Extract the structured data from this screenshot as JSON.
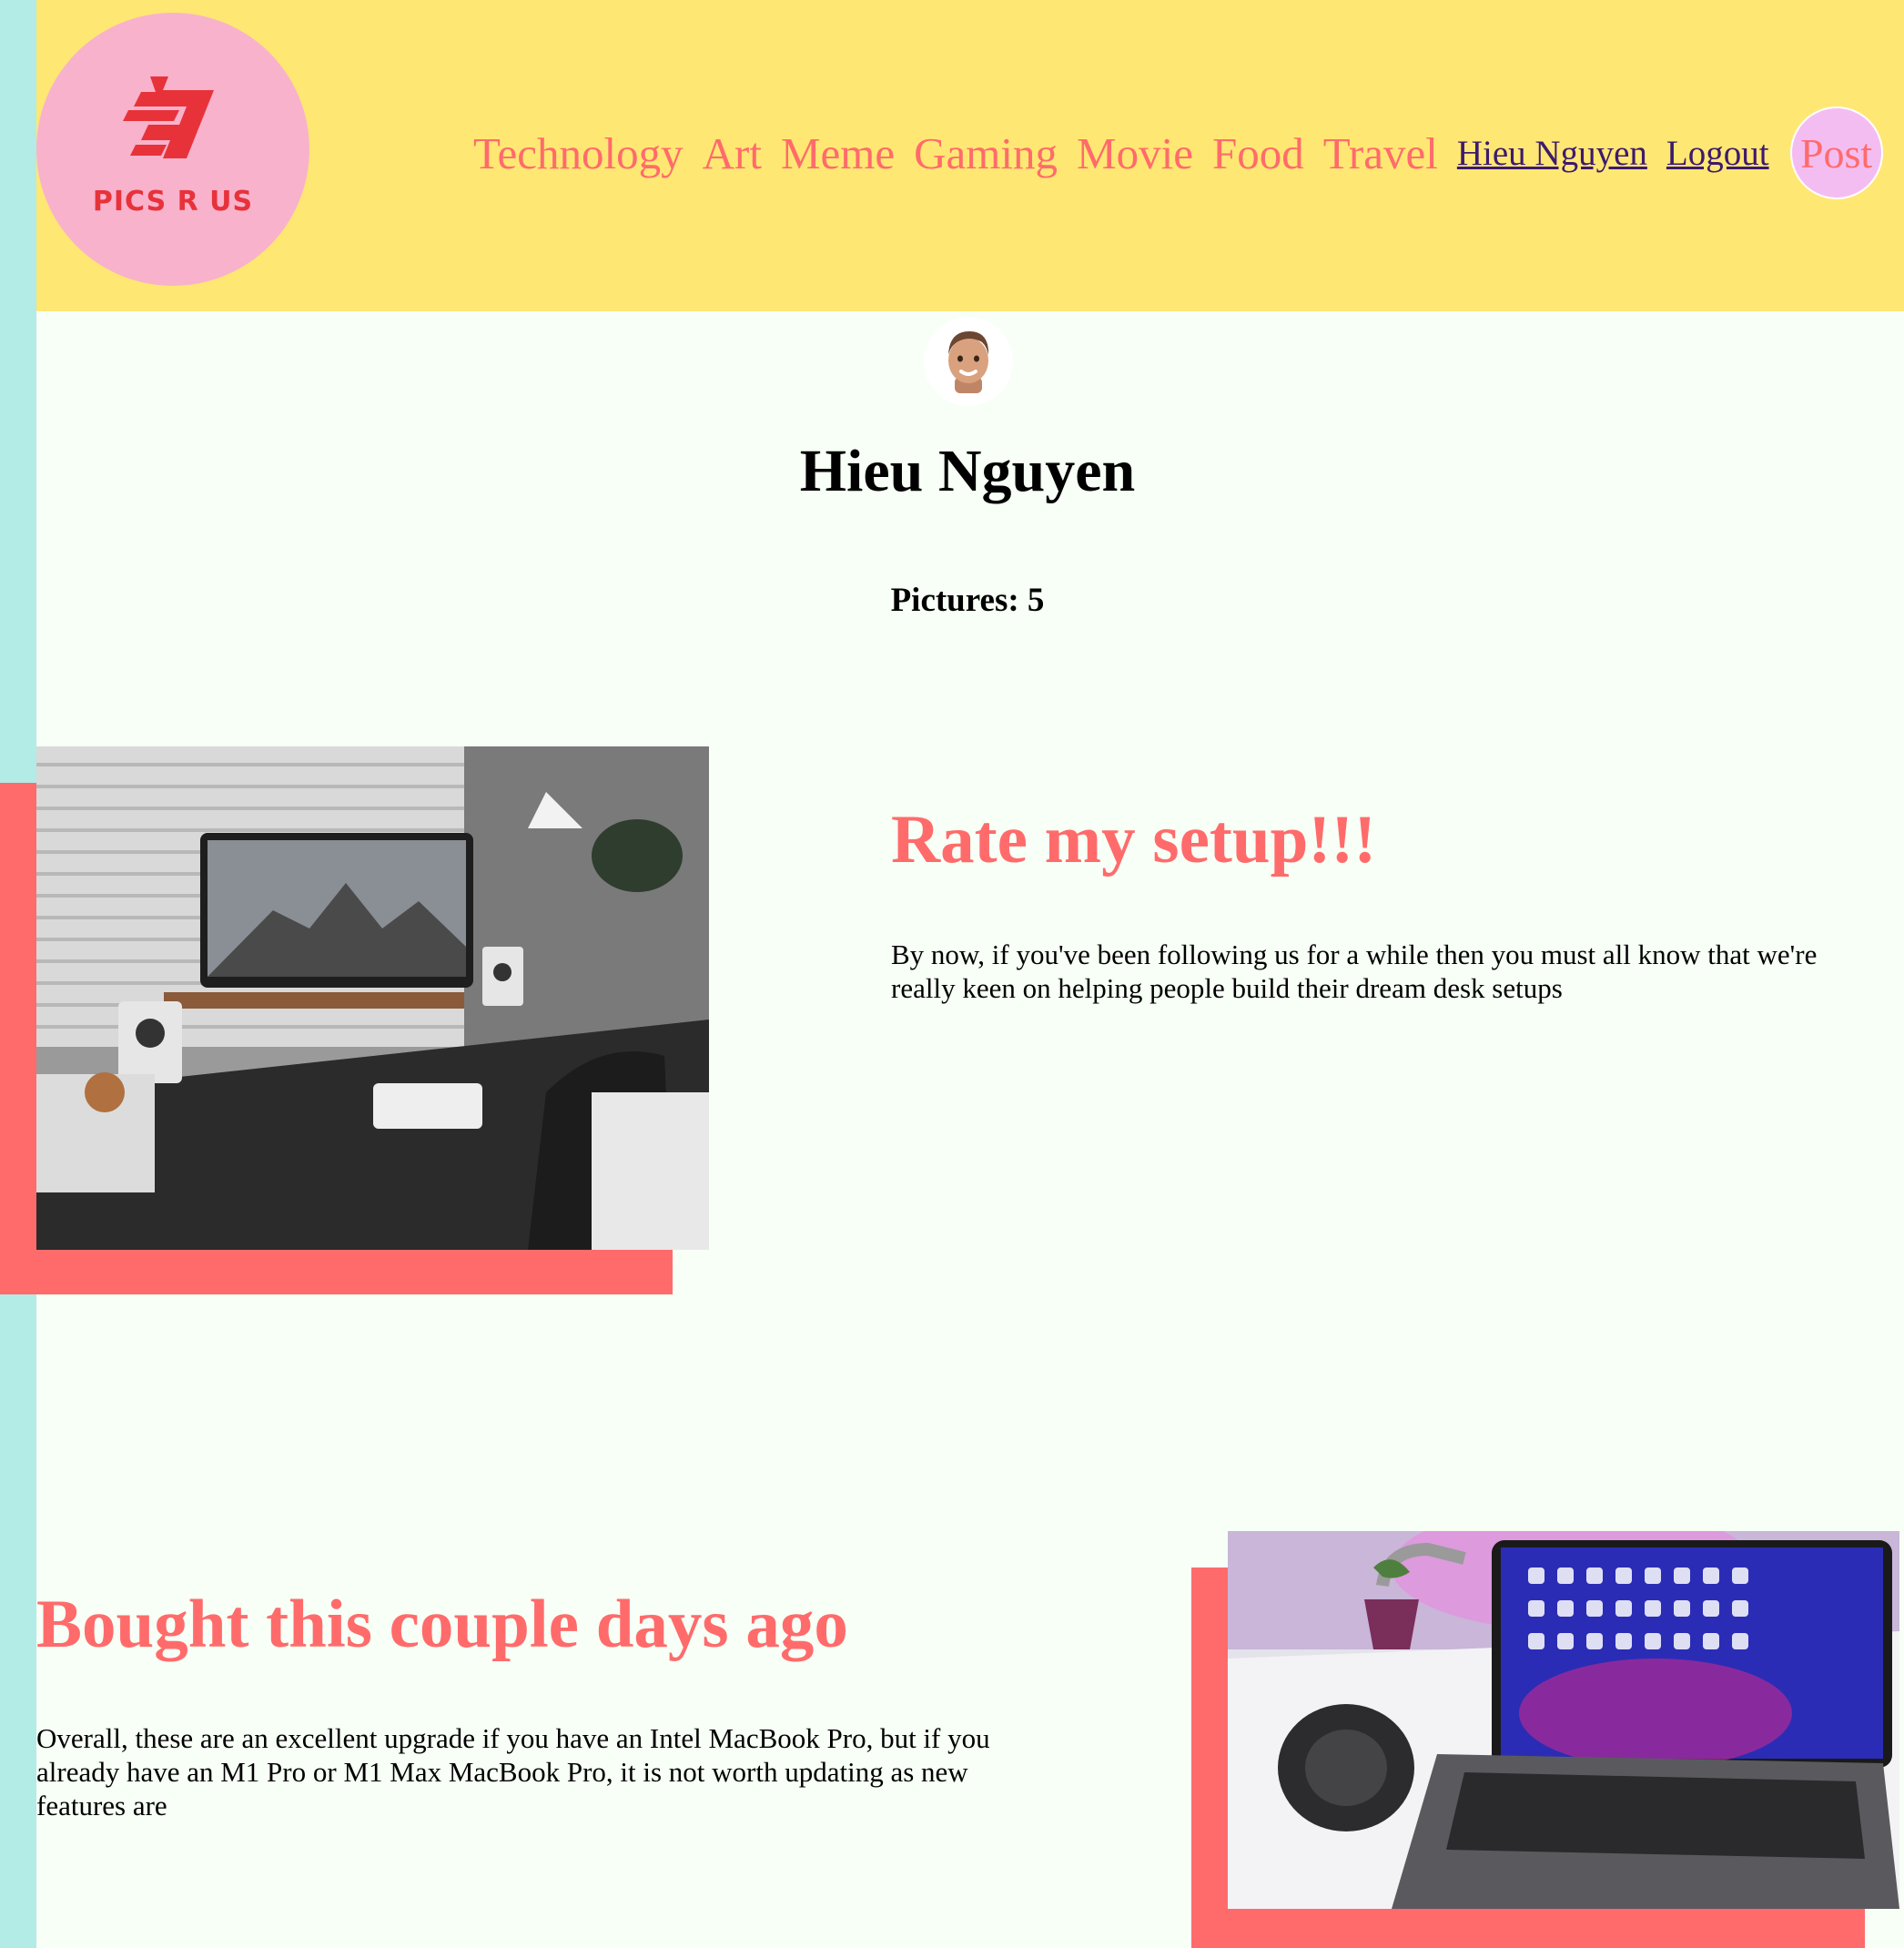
{
  "logo": {
    "text": "PICS R US",
    "brand_color": "#e8323a"
  },
  "nav": {
    "categories": [
      "Technology",
      "Art",
      "Meme",
      "Gaming",
      "Movie",
      "Food",
      "Travel"
    ],
    "user_link": "Hieu Nguyen",
    "logout_link": "Logout",
    "post_button": "Post"
  },
  "profile": {
    "name": "Hieu Nguyen",
    "pictures_label": "Pictures: 5"
  },
  "posts": [
    {
      "title": "Rate my setup!!!",
      "body": "By now, if you've been following us for a while then you must all know that we're really keen on helping people build their dream desk setups",
      "image": "desk-setup-photo"
    },
    {
      "title": "Bought this couple days ago",
      "body": "Overall, these are an excellent upgrade if you have an Intel MacBook Pro, but if you already have an M1 Pro or M1 Max MacBook Pro, it is not worth updating as new features are",
      "image": "macbook-headphones-photo"
    }
  ],
  "colors": {
    "header_bg": "#ffe773",
    "side_strip": "#b3ebe6",
    "accent": "#ff6b6b",
    "page_bg": "#f7fff6",
    "post_button_bg": "#f4bdf2"
  }
}
